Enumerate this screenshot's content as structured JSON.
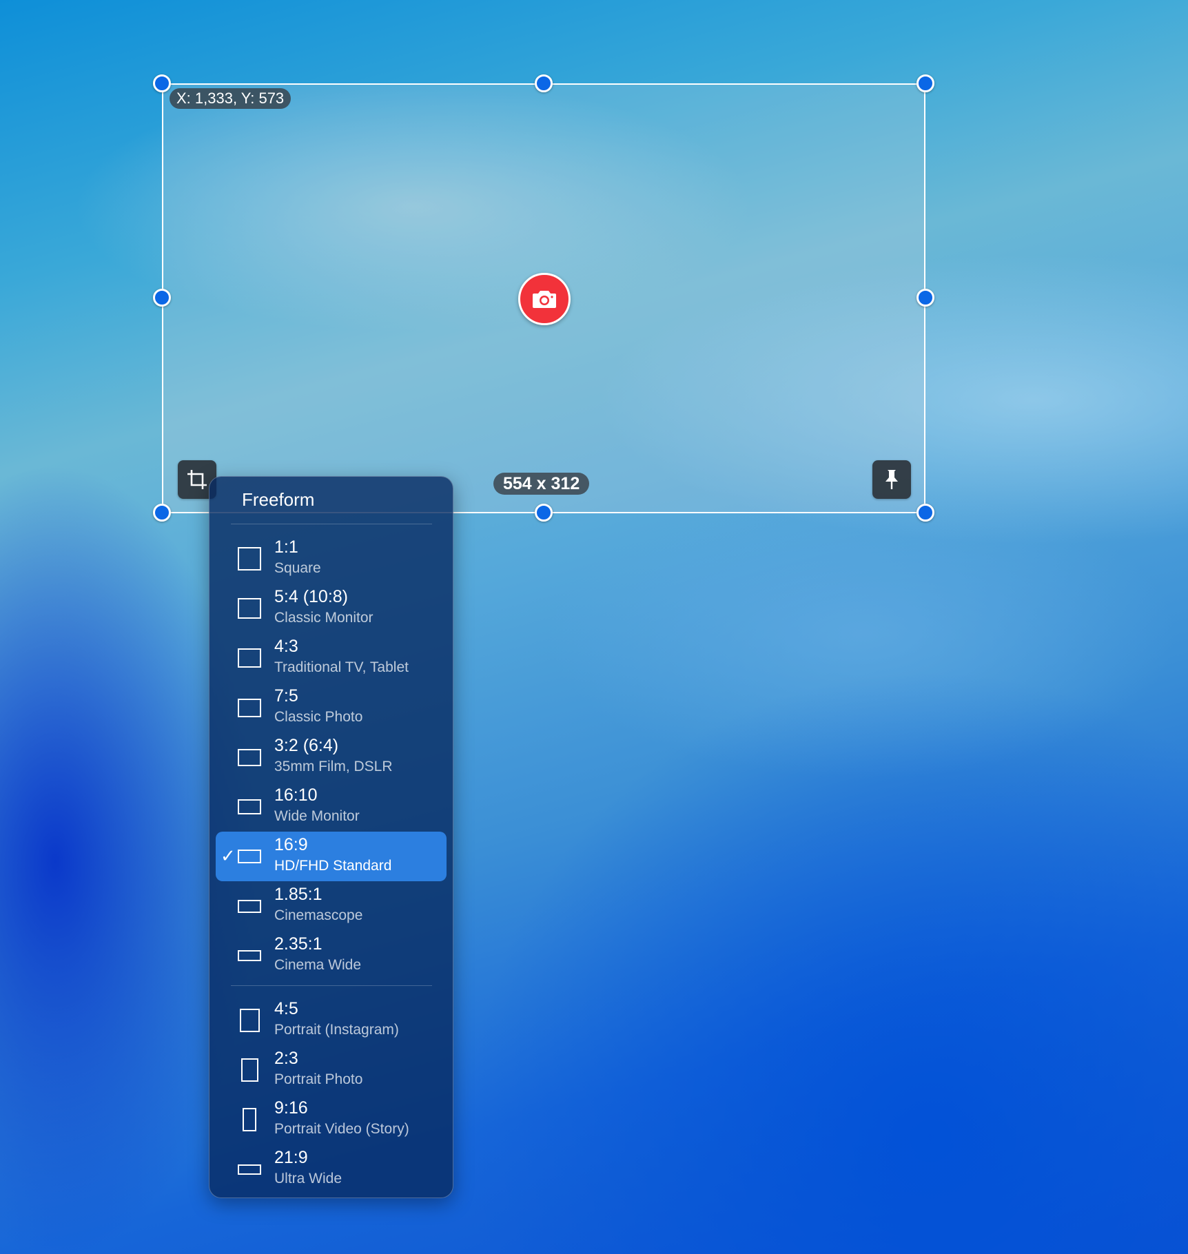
{
  "overlay": {
    "coordinates": "X: 1,333, Y: 573",
    "dimensions": "554 x 312"
  },
  "icons": {
    "capture": "camera-icon",
    "crop": "crop-icon",
    "pin": "pin-icon",
    "check": "checkmark-icon"
  },
  "colors": {
    "handle": "#0b67e6",
    "capture_button": "#f2323a",
    "selected_item": "#2c7fe0"
  },
  "menu": {
    "freeform_label": "Freeform",
    "selected_ratio": "16:9",
    "check_glyph": "✓",
    "landscape_items": [
      {
        "ratio": "1:1",
        "description": "Square"
      },
      {
        "ratio": "5:4 (10:8)",
        "description": "Classic Monitor"
      },
      {
        "ratio": "4:3",
        "description": "Traditional TV, Tablet"
      },
      {
        "ratio": "7:5",
        "description": "Classic Photo"
      },
      {
        "ratio": "3:2 (6:4)",
        "description": "35mm Film, DSLR"
      },
      {
        "ratio": "16:10",
        "description": "Wide Monitor"
      },
      {
        "ratio": "16:9",
        "description": "HD/FHD Standard"
      },
      {
        "ratio": "1.85:1",
        "description": "Cinemascope"
      },
      {
        "ratio": "2.35:1",
        "description": "Cinema Wide"
      }
    ],
    "portrait_items": [
      {
        "ratio": "4:5",
        "description": "Portrait (Instagram)"
      },
      {
        "ratio": "2:3",
        "description": "Portrait Photo"
      },
      {
        "ratio": "9:16",
        "description": "Portrait Video (Story)"
      },
      {
        "ratio": "21:9",
        "description": "Ultra Wide"
      }
    ]
  }
}
